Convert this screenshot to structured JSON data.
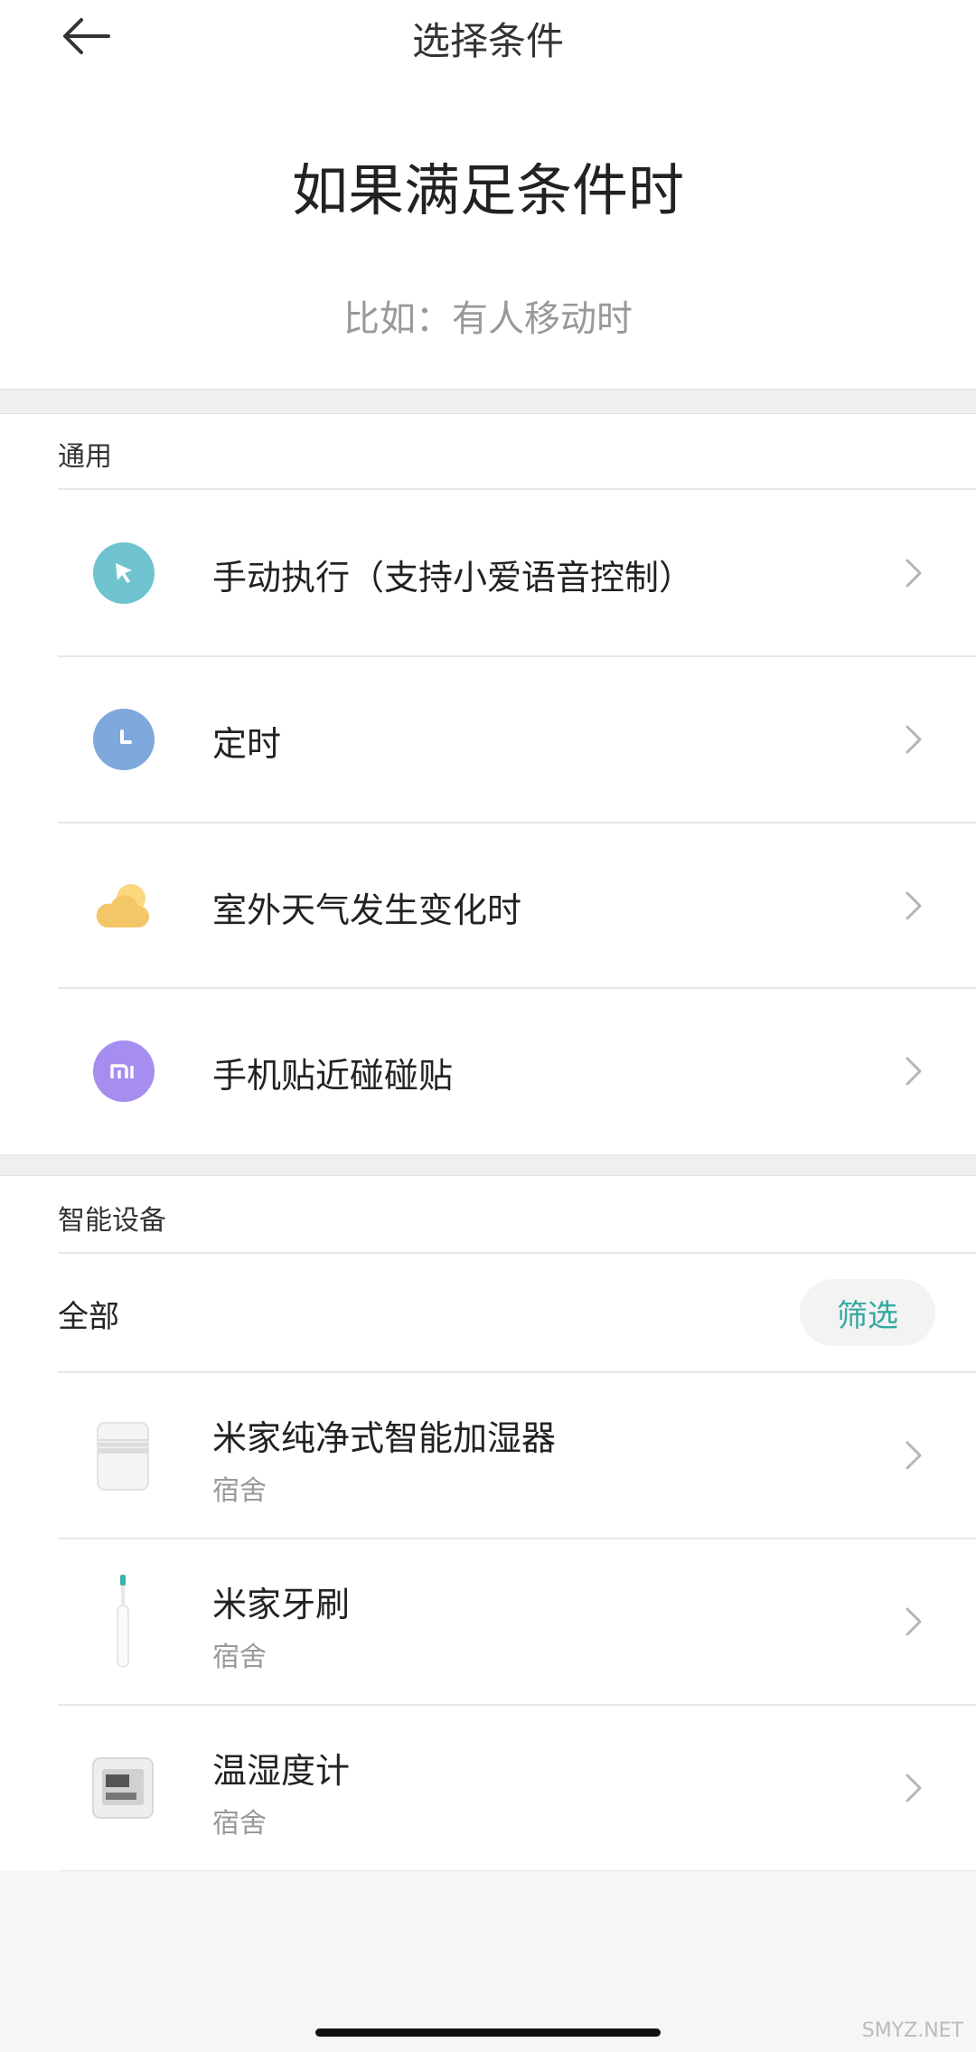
{
  "header": {
    "title": "选择条件"
  },
  "hero": {
    "title": "如果满足条件时",
    "subtitle": "比如：有人移动时"
  },
  "general": {
    "section_label": "通用",
    "items": [
      {
        "label": "手动执行（支持小爱语音控制）",
        "icon": "cursor-icon",
        "color": "#6fc3cf"
      },
      {
        "label": "定时",
        "icon": "clock-icon",
        "color": "#7fa8dc"
      },
      {
        "label": "室外天气发生变化时",
        "icon": "weather-cloud-icon",
        "color": "#f5c667"
      },
      {
        "label": "手机贴近碰碰贴",
        "icon": "mi-logo-icon",
        "color": "#a58ef0"
      }
    ]
  },
  "smart_devices": {
    "section_label": "智能设备",
    "filter": {
      "all_label": "全部",
      "filter_button": "筛选"
    },
    "devices": [
      {
        "name": "米家纯净式智能加湿器",
        "room": "宿舍",
        "icon": "humidifier-icon"
      },
      {
        "name": "米家牙刷",
        "room": "宿舍",
        "icon": "toothbrush-icon"
      },
      {
        "name": "温湿度计",
        "room": "宿舍",
        "icon": "thermometer-hygrometer-icon"
      }
    ]
  },
  "colors": {
    "accent": "#35a8a0",
    "separator": "#efefef",
    "secondary_text": "#999999"
  },
  "watermark": "SMYZ.NET"
}
